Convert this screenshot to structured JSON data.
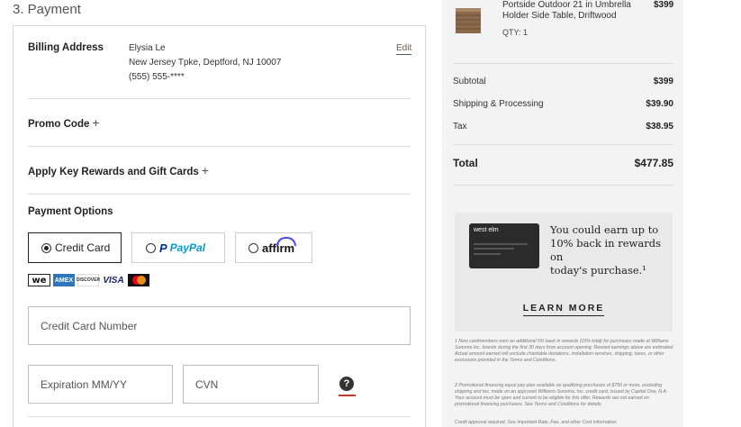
{
  "section_title": "3. Payment",
  "billing": {
    "label": "Billing Address",
    "name": "Elysia Le",
    "address": "New Jersey Tpke, Deptford, NJ 10007",
    "phone": "(555) 555-****",
    "edit_label": "Edit"
  },
  "promo_code": {
    "label": "Promo Code",
    "plus": "+"
  },
  "rewards": {
    "label": "Apply Key Rewards and Gift Cards",
    "plus": "+"
  },
  "payment_options": {
    "title": "Payment Options",
    "credit_card_label": "Credit Card",
    "paypal_p": "P",
    "paypal_label": "PayPal",
    "affirm_label": "affirm",
    "selected": "Credit Card"
  },
  "card_logos": [
    "we",
    "AMEX",
    "DISCOVER",
    "VISA",
    "mastercard"
  ],
  "fields": {
    "card_number_placeholder": "Credit Card Number",
    "expiration_placeholder": "Expiration MM/YY",
    "cvn_placeholder": "CVN",
    "help_label": "?"
  },
  "order_item": {
    "name": "Portside Outdoor 21 in Umbrella Holder Side Table, Driftwood",
    "price": "$399",
    "qty": "QTY: 1"
  },
  "summary": {
    "subtotal_label": "Subtotal",
    "subtotal_value": "$399",
    "shipping_label": "Shipping & Processing",
    "shipping_value": "$39.90",
    "tax_label": "Tax",
    "tax_value": "$38.95",
    "total_label": "Total",
    "total_value": "$477.85"
  },
  "promo_banner": {
    "card_brand": "west elm",
    "text_1": "You could earn up to",
    "text_2": "10% back in rewards on",
    "text_3": "today's purchase.¹",
    "cta": "LEARN MORE"
  },
  "fine_print": {
    "note1": "1 New cardmembers earn an additional 5% back in rewards (10% total) for purchases made at Williams Sonoma Inc. brands during the first 30 days from account opening. Reward earnings above are estimated. Actual amount earned will exclude charitable donations, installation services, shipping, taxes, or other exclusions provided in the Terms and Conditions.",
    "note2": "2 Promotional financing equal pay plan available on qualifying purchases of $750 or more, excluding shipping and tax, made on an approved Williams-Sonoma, Inc. credit card, issued by Capital One, N.A. Your account must be open and current to be eligible for this offer. Rewards are not earned on promotional financing purchases. See Terms and Conditions for details.",
    "note3": "Credit approval required. See Important Rate, Fee, and other Cost information."
  },
  "colors": {
    "accent": "#6b5a48",
    "help_underline": "#c0392b",
    "summary_bg": "#f3f3f3"
  }
}
